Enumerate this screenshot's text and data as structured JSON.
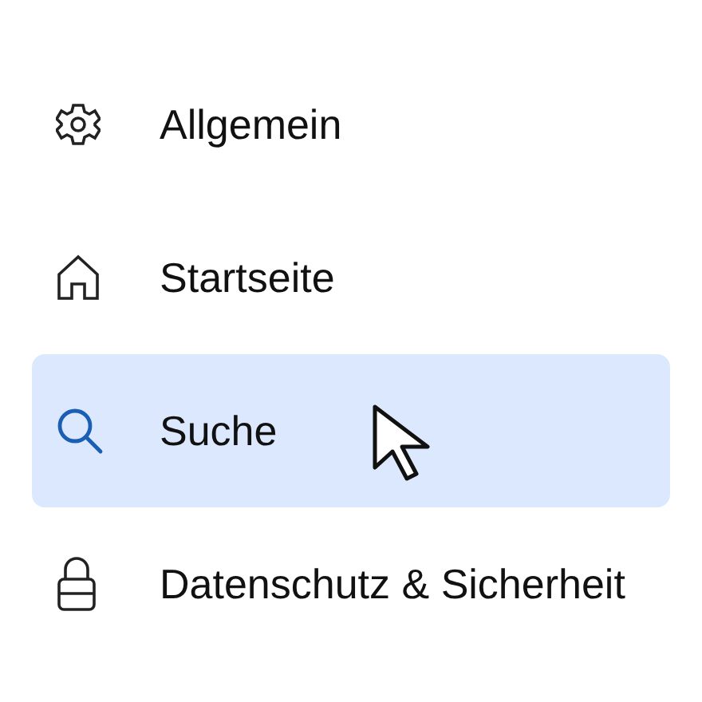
{
  "menu": {
    "items": [
      {
        "label": "Allgemein",
        "selected": false
      },
      {
        "label": "Startseite",
        "selected": false
      },
      {
        "label": "Suche",
        "selected": true
      },
      {
        "label": "Datenschutz & Sicherheit",
        "selected": false
      }
    ]
  }
}
